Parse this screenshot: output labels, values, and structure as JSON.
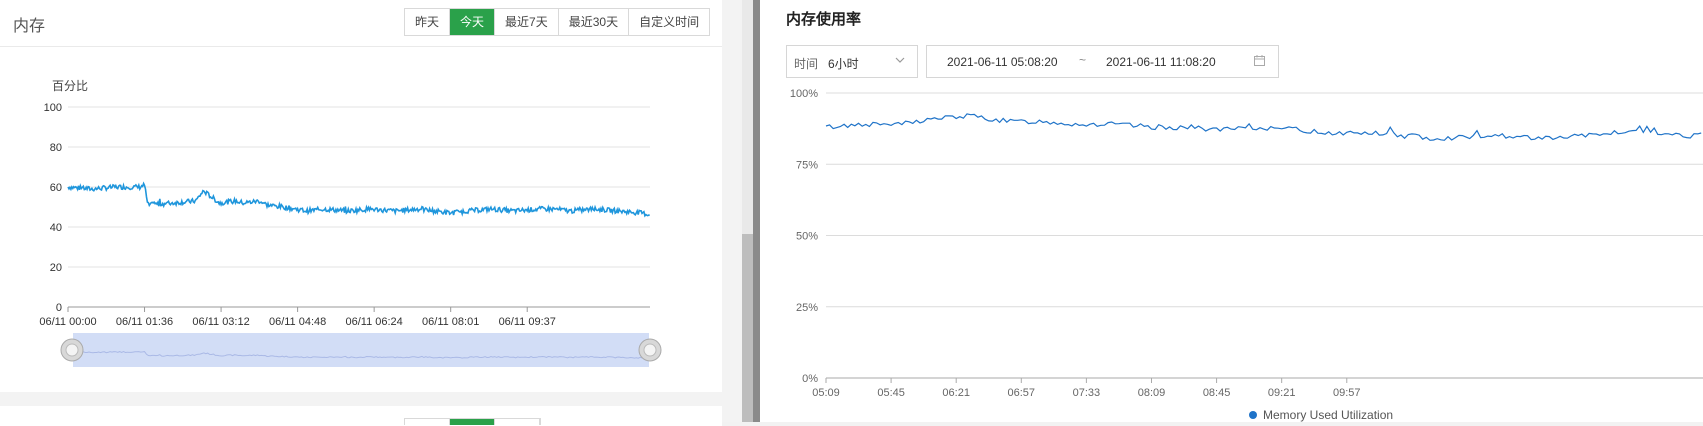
{
  "left_panel": {
    "title": "内存",
    "range_buttons": [
      "昨天",
      "今天",
      "最近7天",
      "最近30天",
      "自定义时间"
    ],
    "active_range": "今天",
    "chart_data": {
      "type": "line",
      "ylabel": "百分比",
      "ylim": [
        0,
        100
      ],
      "yticks": [
        "0",
        "20",
        "40",
        "60",
        "80",
        "100"
      ],
      "xticks": [
        "06/11 00:00",
        "06/11 01:36",
        "06/11 03:12",
        "06/11 04:48",
        "06/11 06:24",
        "06/11 08:01",
        "06/11 09:37"
      ],
      "x": [
        0,
        30,
        60,
        90,
        96,
        100,
        130,
        160,
        170,
        190,
        210,
        220,
        240,
        250,
        270,
        300,
        320,
        350,
        380,
        410,
        440,
        460,
        480,
        500,
        530,
        560,
        590,
        610,
        630,
        660,
        690,
        720,
        730
      ],
      "y": [
        60,
        59,
        60,
        60,
        61,
        51,
        52,
        53,
        58,
        52,
        53,
        52,
        53,
        51,
        50,
        48,
        49,
        48,
        49,
        48,
        49,
        48,
        47,
        48,
        49,
        48,
        49,
        49,
        48,
        49,
        48,
        47,
        46
      ],
      "x_domain_minutes": [
        0,
        730
      ],
      "color": "#1f96dc",
      "grid": true
    }
  },
  "right_panel": {
    "title": "内存使用率",
    "time_label": "时间",
    "time_value": "6小时",
    "start": "2021-06-11 05:08:20",
    "tilde": "~",
    "end": "2021-06-11 11:08:20",
    "legend": "Memory Used Utilization",
    "chart_data": {
      "type": "line",
      "ylim": [
        0,
        100
      ],
      "yticks": [
        "0%",
        "25%",
        "50%",
        "75%",
        "100%"
      ],
      "xticks": [
        "05:09",
        "05:45",
        "06:21",
        "06:57",
        "07:33",
        "08:09",
        "08:45",
        "09:21",
        "09:57"
      ],
      "series": [
        {
          "name": "Memory Used Utilization",
          "color": "#1f73c8",
          "x": [
            0,
            20,
            40,
            60,
            80,
            100,
            120,
            140,
            160,
            180,
            200,
            220,
            240,
            260,
            280,
            300,
            320,
            340,
            360,
            380,
            400,
            420,
            440,
            460,
            480,
            500
          ],
          "y": [
            88,
            89,
            89,
            91,
            92,
            90,
            90,
            89,
            89,
            88,
            88,
            87,
            88,
            87,
            86,
            86,
            85,
            84,
            85,
            85,
            84,
            85,
            86,
            86,
            85,
            86
          ]
        }
      ],
      "x_domain_minutes": [
        0,
        485
      ],
      "grid": true
    }
  },
  "colors": {
    "accent_green": "#2aa14a",
    "left_line": "#1f96dc",
    "right_line": "#1f73c8"
  }
}
